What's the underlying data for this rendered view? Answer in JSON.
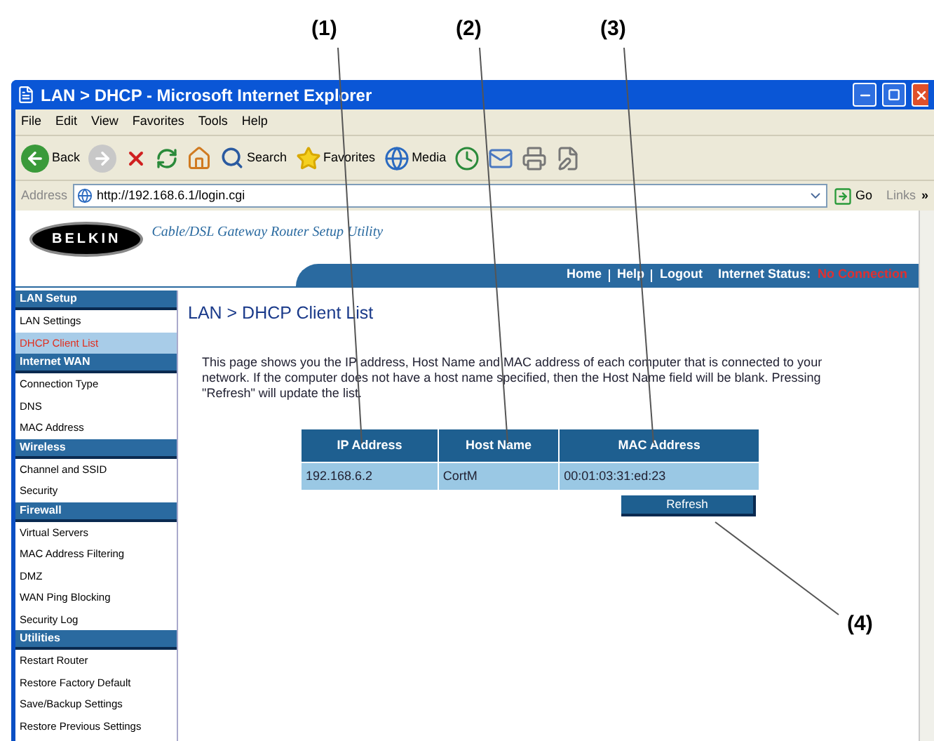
{
  "callouts": [
    {
      "label": "(1)"
    },
    {
      "label": "(2)"
    },
    {
      "label": "(3)"
    },
    {
      "label": "(4)"
    }
  ],
  "window": {
    "title": "LAN > DHCP - Microsoft Internet Explorer"
  },
  "menu": [
    "File",
    "Edit",
    "View",
    "Favorites",
    "Tools",
    "Help"
  ],
  "toolbar": [
    {
      "kind": "back",
      "label": "Back"
    },
    {
      "kind": "forward"
    },
    {
      "kind": "stop"
    },
    {
      "kind": "refresh"
    },
    {
      "kind": "home"
    },
    {
      "kind": "search",
      "label": "Search"
    },
    {
      "kind": "favorites",
      "label": "Favorites"
    },
    {
      "kind": "media",
      "label": "Media"
    },
    {
      "kind": "history"
    },
    {
      "kind": "mail"
    },
    {
      "kind": "print"
    },
    {
      "kind": "edit"
    }
  ],
  "address_bar": {
    "label": "Address",
    "value": "http://192.168.6.1/login.cgi",
    "go": "Go",
    "links": "Links",
    "more": "»"
  },
  "header": {
    "logo": "BELKIN",
    "tagline": "Cable/DSL Gateway Router Setup Utility",
    "nav": [
      "Home",
      "Help",
      "Logout"
    ],
    "status_label": "Internet Status:",
    "status_value": "No Connection"
  },
  "sidebar": [
    {
      "title": "LAN Setup",
      "items": [
        {
          "label": "LAN Settings",
          "selected": false
        },
        {
          "label": "DHCP Client List",
          "selected": true
        }
      ]
    },
    {
      "title": "Internet WAN",
      "items": [
        {
          "label": "Connection Type",
          "selected": false
        },
        {
          "label": "DNS",
          "selected": false
        },
        {
          "label": "MAC Address",
          "selected": false
        }
      ]
    },
    {
      "title": "Wireless",
      "items": [
        {
          "label": "Channel and SSID",
          "selected": false
        },
        {
          "label": "Security",
          "selected": false
        }
      ]
    },
    {
      "title": "Firewall",
      "items": [
        {
          "label": "Virtual Servers",
          "selected": false
        },
        {
          "label": "MAC Address Filtering",
          "selected": false
        },
        {
          "label": "DMZ",
          "selected": false
        },
        {
          "label": "WAN Ping Blocking",
          "selected": false
        },
        {
          "label": "Security Log",
          "selected": false
        }
      ]
    },
    {
      "title": "Utilities",
      "items": [
        {
          "label": "Restart Router",
          "selected": false
        },
        {
          "label": "Restore Factory Default",
          "selected": false
        },
        {
          "label": "Save/Backup Settings",
          "selected": false
        },
        {
          "label": "Restore Previous Settings",
          "selected": false
        }
      ]
    }
  ],
  "page": {
    "title": "LAN > DHCP Client List",
    "description": "This page shows you the IP address, Host Name and MAC address of each computer that is connected to your network. If the computer does not have a host name specified, then the Host Name field will be blank. Pressing \"Refresh\" will update the list.",
    "table": {
      "columns": [
        "IP Address",
        "Host Name",
        "MAC Address"
      ],
      "rows": [
        [
          "192.168.6.2",
          "CortM",
          "00:01:03:31:ed:23"
        ]
      ]
    },
    "refresh_button": "Refresh"
  }
}
